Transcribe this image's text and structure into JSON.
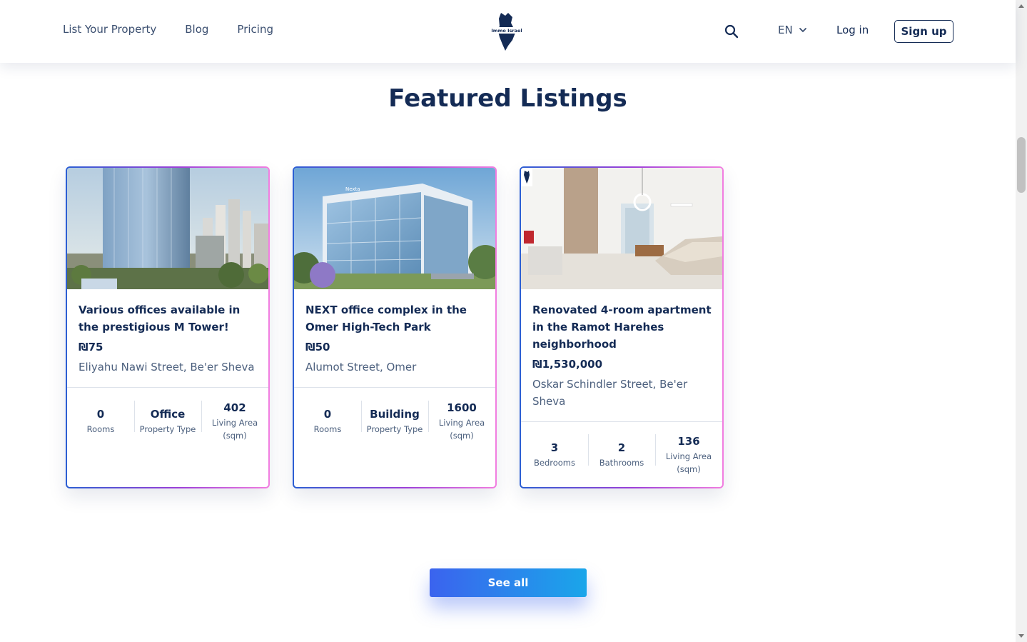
{
  "header": {
    "nav": [
      "List Your Property",
      "Blog",
      "Pricing"
    ],
    "logo_text": "Immo Israel",
    "language": "EN",
    "login_label": "Log in",
    "signup_label": "Sign up"
  },
  "section_title": "Featured Listings",
  "listings": [
    {
      "title": "Various offices available in the prestigious M Tower!",
      "price": "₪75",
      "address": "Eliyahu Nawi Street, Be'er Sheva",
      "stats": [
        {
          "value": "0",
          "label": "Rooms"
        },
        {
          "value": "Office",
          "label": "Property Type"
        },
        {
          "value": "402",
          "label": "Living Area (sqm)"
        }
      ]
    },
    {
      "title": "NEXT office complex in the Omer High-Tech Park",
      "price": "₪50",
      "address": "Alumot Street, Omer",
      "stats": [
        {
          "value": "0",
          "label": "Rooms"
        },
        {
          "value": "Building",
          "label": "Property Type"
        },
        {
          "value": "1600",
          "label": "Living Area (sqm)"
        }
      ]
    },
    {
      "title": "Renovated 4-room apartment in the Ramot Harehes neighborhood",
      "price": "₪1,530,000",
      "address": "Oskar Schindler Street, Be'er Sheva",
      "stats": [
        {
          "value": "3",
          "label": "Bedrooms"
        },
        {
          "value": "2",
          "label": "Bathrooms"
        },
        {
          "value": "136",
          "label": "Living Area (sqm)"
        }
      ]
    }
  ],
  "see_all_label": "See all",
  "colors": {
    "navy": "#142b55",
    "text_muted": "#4b5f7d",
    "card_border_start": "#2b5fd3",
    "card_border_end": "#f27ee0",
    "button_start": "#3b63ee",
    "button_end": "#1aa6ea"
  }
}
